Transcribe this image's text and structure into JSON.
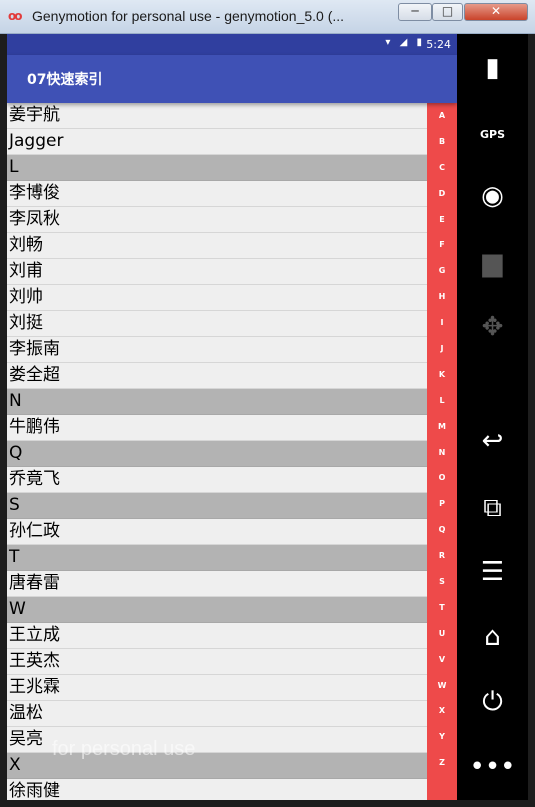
{
  "window": {
    "title": "Genymotion for personal use - genymotion_5.0 (...",
    "minimize": "─",
    "maximize": "□",
    "close": "✕",
    "app_icon": "oo"
  },
  "status_bar": {
    "icons": "▾ ◢ ▮",
    "time": "5:24"
  },
  "app_bar": {
    "title": "07快速索引"
  },
  "list": [
    {
      "text": "姜宇航",
      "header": false
    },
    {
      "text": "Jagger",
      "header": false
    },
    {
      "text": "L",
      "header": true
    },
    {
      "text": "李博俊",
      "header": false
    },
    {
      "text": "李凤秋",
      "header": false
    },
    {
      "text": "刘畅",
      "header": false
    },
    {
      "text": "刘甫",
      "header": false
    },
    {
      "text": "刘帅",
      "header": false
    },
    {
      "text": "刘挺",
      "header": false
    },
    {
      "text": "李振南",
      "header": false
    },
    {
      "text": "娄全超",
      "header": false
    },
    {
      "text": "N",
      "header": true
    },
    {
      "text": "牛鹏伟",
      "header": false
    },
    {
      "text": "Q",
      "header": true
    },
    {
      "text": "乔竟飞",
      "header": false
    },
    {
      "text": "S",
      "header": true
    },
    {
      "text": "孙仁政",
      "header": false
    },
    {
      "text": "T",
      "header": true
    },
    {
      "text": "唐春雷",
      "header": false
    },
    {
      "text": "W",
      "header": true
    },
    {
      "text": "王立成",
      "header": false
    },
    {
      "text": "王英杰",
      "header": false
    },
    {
      "text": "王兆霖",
      "header": false
    },
    {
      "text": "温松",
      "header": false
    },
    {
      "text": "吴亮",
      "header": false
    },
    {
      "text": "X",
      "header": true
    },
    {
      "text": "徐雨健",
      "header": false
    }
  ],
  "index_letters": [
    "A",
    "B",
    "C",
    "D",
    "E",
    "F",
    "G",
    "H",
    "I",
    "J",
    "K",
    "L",
    "M",
    "N",
    "O",
    "P",
    "Q",
    "R",
    "S",
    "T",
    "U",
    "V",
    "W",
    "X",
    "Y",
    "Z"
  ],
  "watermark": "for personal use",
  "side_panel": [
    {
      "icon": "battery-icon",
      "glyph": "▮",
      "dim": false
    },
    {
      "icon": "gps-icon",
      "glyph": "GPS",
      "dim": false
    },
    {
      "icon": "camera-icon",
      "glyph": "◉",
      "dim": false
    },
    {
      "icon": "video-icon",
      "glyph": "▆",
      "dim": true
    },
    {
      "icon": "dpad-icon",
      "glyph": "✥",
      "dim": true
    },
    {
      "icon": "back-icon",
      "glyph": "↩",
      "dim": false
    },
    {
      "icon": "recent-apps-icon",
      "glyph": "⧉",
      "dim": false
    },
    {
      "icon": "menu-icon",
      "glyph": "☰",
      "dim": false
    },
    {
      "icon": "home-icon",
      "glyph": "⌂",
      "dim": false
    },
    {
      "icon": "power-icon",
      "glyph": "⏻",
      "dim": false
    },
    {
      "icon": "more-icon",
      "glyph": "•••",
      "dim": false
    }
  ],
  "colors": {
    "status_bar": "#303f9f",
    "app_bar": "#3f51b5",
    "index_bar": "#ee4a4a",
    "section_header": "#b3b3b3"
  }
}
